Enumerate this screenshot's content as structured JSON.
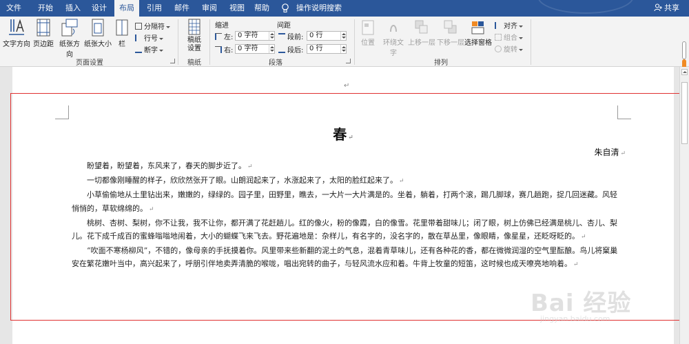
{
  "tabs": [
    "文件",
    "开始",
    "插入",
    "设计",
    "布局",
    "引用",
    "邮件",
    "审阅",
    "视图",
    "帮助"
  ],
  "active_tab": "布局",
  "tell_me": "操作说明搜索",
  "share": "共享",
  "ribbon": {
    "page_setup": {
      "label": "页面设置",
      "text_direction": "文字方向",
      "margins": "页边距",
      "orientation": "纸张方向",
      "size": "纸张大小",
      "columns": "栏",
      "breaks": "分隔符",
      "line_numbers": "行号",
      "hyphenation": "断字"
    },
    "draft": {
      "label": "稿纸",
      "button": "稿纸设置"
    },
    "paragraph": {
      "label": "段落",
      "indent_title": "缩进",
      "spacing_title": "间距",
      "left_label": "左:",
      "left_value": "0 字符",
      "right_label": "右:",
      "right_value": "0 字符",
      "before_label": "段前:",
      "before_value": "0 行",
      "after_label": "段后:",
      "after_value": "0 行"
    },
    "arrange": {
      "label": "排列",
      "position": "位置",
      "wrap": "环绕文字",
      "forward": "上移一层",
      "backward": "下移一层",
      "selection_pane": "选择窗格",
      "align": "对齐",
      "group": "组合",
      "rotate": "旋转"
    }
  },
  "document": {
    "title": "春",
    "author": "朱自清",
    "paragraphs": [
      "盼望着，盼望着，东风来了，春天的脚步近了。",
      "一切都像刚睡醒的样子，欣欣然张开了眼。山朗润起来了，水涨起来了，太阳的脸红起来了。",
      "小草偷偷地从土里钻出来，嫩嫩的，绿绿的。园子里，田野里，瞧去，一大片一大片满是的。坐着，躺着，打两个滚，踢几脚球，赛几趟跑，捉几回迷藏。风轻悄悄的，草软绵绵的。",
      "桃树、杏树、梨树，你不让我，我不让你，都开满了花赶趟儿。红的像火，粉的像霞，白的像雪。花里带着甜味儿；闭了眼，树上仿佛已经满是桃儿、杏儿、梨儿。花下成千成百的蜜蜂嗡嗡地闹着，大小的蝴蝶飞来飞去。野花遍地是：杂样儿，有名字的，没名字的，散在草丛里，像眼睛，像星星，还眨呀眨的。",
      "“吹面不寒杨柳风”，不错的，像母亲的手抚摸着你。风里带来些新翻的泥土的气息，混着青草味儿，还有各种花的香，都在微微润湿的空气里酝酿。鸟儿将窠巢安在繁花嫩叶当中，高兴起来了，呼朋引伴地卖弄清脆的喉咙，唱出宛转的曲子，与轻风流水应和着。牛背上牧童的短笛，这时候也成天嘹亮地响着。"
    ],
    "para_mark": "↵"
  },
  "watermark": {
    "main": "Bai 经验",
    "sub": "jingyan.baidu.com"
  },
  "colors": {
    "ribbon_blue": "#2b579a",
    "highlight_red": "#e03030",
    "accent_orange": "#f08a24"
  }
}
